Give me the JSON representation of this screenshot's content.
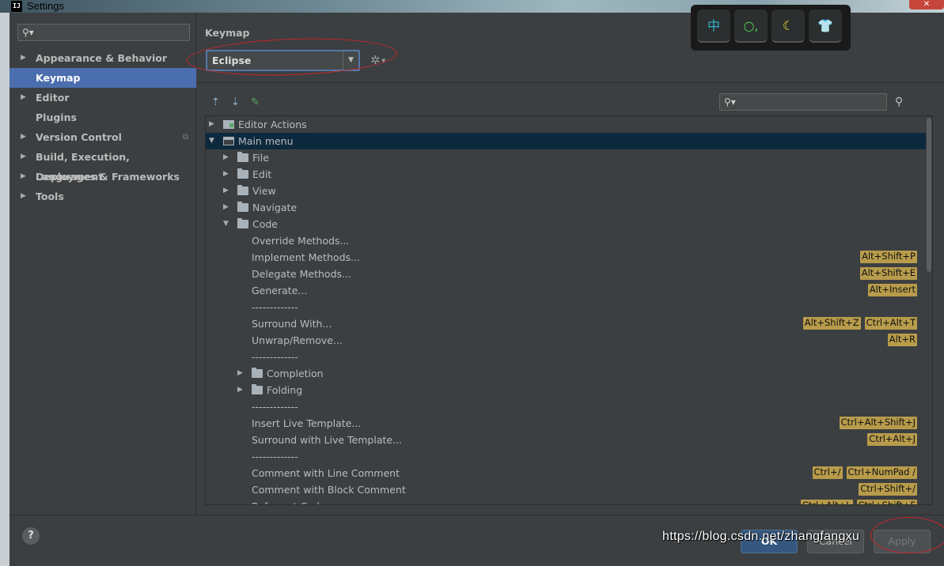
{
  "window": {
    "title": "Settings",
    "app_icon": "IJ",
    "close": "✕"
  },
  "sidebar": {
    "search_placeholder": "",
    "items": [
      {
        "label": "Appearance & Behavior",
        "expandable": true
      },
      {
        "label": "Keymap",
        "expandable": false,
        "selected": true
      },
      {
        "label": "Editor",
        "expandable": true
      },
      {
        "label": "Plugins",
        "expandable": false
      },
      {
        "label": "Version Control",
        "expandable": true,
        "copy_icon": true
      },
      {
        "label": "Build, Execution, Deployment",
        "expandable": true
      },
      {
        "label": "Languages & Frameworks",
        "expandable": true
      },
      {
        "label": "Tools",
        "expandable": true
      }
    ]
  },
  "main": {
    "title": "Keymap",
    "keymap_value": "Eclipse",
    "search_placeholder": ""
  },
  "tree": [
    {
      "label": "Editor Actions",
      "level": 0,
      "icon": "actions",
      "state": "collapsed"
    },
    {
      "label": "Main menu",
      "level": 0,
      "icon": "menu",
      "state": "expanded",
      "selected": true
    },
    {
      "label": "File",
      "level": 1,
      "icon": "folder",
      "state": "collapsed"
    },
    {
      "label": "Edit",
      "level": 1,
      "icon": "folder",
      "state": "collapsed"
    },
    {
      "label": "View",
      "level": 1,
      "icon": "folder",
      "state": "collapsed"
    },
    {
      "label": "Navigate",
      "level": 1,
      "icon": "folder",
      "state": "collapsed"
    },
    {
      "label": "Code",
      "level": 1,
      "icon": "folder",
      "state": "expanded"
    },
    {
      "label": "Override Methods...",
      "level": 2,
      "shortcuts": []
    },
    {
      "label": "Implement Methods...",
      "level": 2,
      "shortcuts": [
        "Alt+Shift+P"
      ]
    },
    {
      "label": "Delegate Methods...",
      "level": 2,
      "shortcuts": [
        "Alt+Shift+E"
      ]
    },
    {
      "label": "Generate...",
      "level": 2,
      "shortcuts": [
        "Alt+Insert"
      ]
    },
    {
      "label": "-------------",
      "level": 2,
      "shortcuts": []
    },
    {
      "label": "Surround With...",
      "level": 2,
      "shortcuts": [
        "Alt+Shift+Z",
        "Ctrl+Alt+T"
      ]
    },
    {
      "label": "Unwrap/Remove...",
      "level": 2,
      "shortcuts": [
        "Alt+R"
      ]
    },
    {
      "label": "-------------",
      "level": 2,
      "shortcuts": []
    },
    {
      "label": "Completion",
      "level": 2,
      "icon": "folder",
      "state": "collapsed"
    },
    {
      "label": "Folding",
      "level": 2,
      "icon": "folder",
      "state": "collapsed"
    },
    {
      "label": "-------------",
      "level": 2,
      "shortcuts": []
    },
    {
      "label": "Insert Live Template...",
      "level": 2,
      "shortcuts": [
        "Ctrl+Alt+Shift+J"
      ]
    },
    {
      "label": "Surround with Live Template...",
      "level": 2,
      "shortcuts": [
        "Ctrl+Alt+J"
      ]
    },
    {
      "label": "-------------",
      "level": 2,
      "shortcuts": []
    },
    {
      "label": "Comment with Line Comment",
      "level": 2,
      "shortcuts": [
        "Ctrl+/",
        "Ctrl+NumPad /"
      ]
    },
    {
      "label": "Comment with Block Comment",
      "level": 2,
      "shortcuts": [
        "Ctrl+Shift+/"
      ]
    },
    {
      "label": "Reformat Code",
      "level": 2,
      "shortcuts": [
        "Ctrl+Alt+L",
        "Ctrl+Shift+F"
      ]
    }
  ],
  "buttons": {
    "help": "?",
    "ok": "OK",
    "cancel": "Cancel",
    "apply": "Apply"
  },
  "ime": {
    "keys": [
      "中",
      "○,",
      "☾",
      "👕"
    ]
  },
  "watermark": "https://blog.csdn.net/zhangfangxu",
  "colors": {
    "selection": "#4b6eaf",
    "tree_selection": "#0d293e",
    "shortcut_bg": "#b89c4b",
    "annotation": "#c8262b"
  }
}
